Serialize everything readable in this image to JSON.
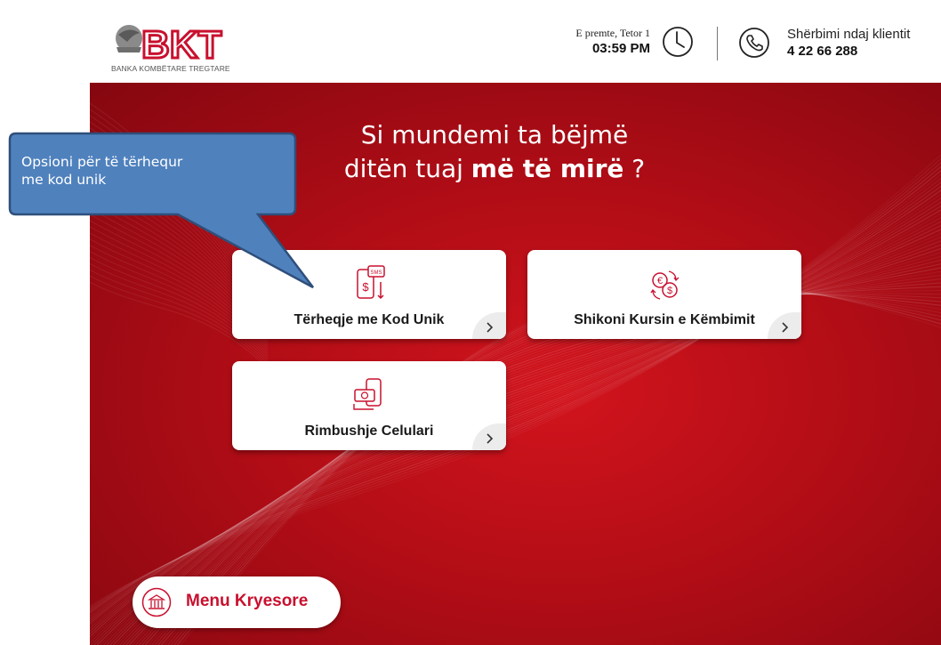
{
  "header": {
    "logo_text": "BKT",
    "logo_subtitle": "BANKA KOMBËTARE TREGTARE",
    "date": "E premte, Tetor 1",
    "time": "03:59 PM",
    "service_label": "Shërbimi ndaj klientit",
    "service_number": "4 22 66 288"
  },
  "hero": {
    "headline_line1": "Si mundemi ta bëjmë",
    "headline_line2_plain": "ditën tuaj ",
    "headline_line2_bold": "më të mirë",
    "headline_line2_end": " ?"
  },
  "cards": [
    {
      "label": "Tërheqje me Kod Unik",
      "icon": "sms-withdraw-icon"
    },
    {
      "label": "Shikoni Kursin e Këmbimit",
      "icon": "currency-exchange-icon"
    },
    {
      "label": "Rimbushje Celulari",
      "icon": "mobile-topup-icon"
    }
  ],
  "menu": {
    "label": "Menu Kryesore",
    "icon": "bank-icon"
  },
  "callout": {
    "line1": "Opsioni për të tërhequr",
    "line2": "me kod unik"
  },
  "colors": {
    "brand_red": "#c8102e",
    "hero_red": "#b20d16",
    "callout_blue": "#4f81bd",
    "callout_border": "#2f4f7a"
  }
}
